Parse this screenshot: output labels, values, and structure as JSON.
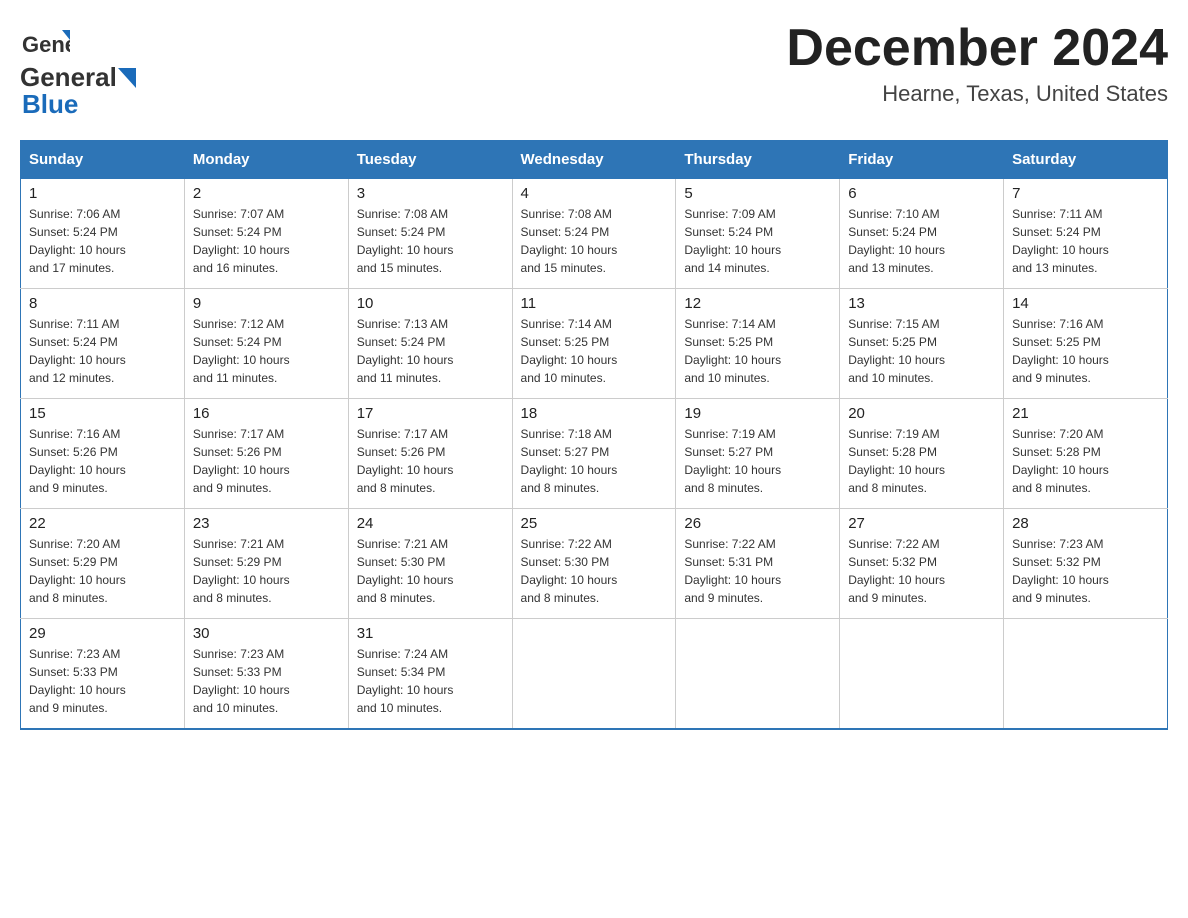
{
  "header": {
    "logo_general": "General",
    "logo_blue": "Blue",
    "title": "December 2024",
    "subtitle": "Hearne, Texas, United States"
  },
  "days_of_week": [
    "Sunday",
    "Monday",
    "Tuesday",
    "Wednesday",
    "Thursday",
    "Friday",
    "Saturday"
  ],
  "weeks": [
    [
      {
        "day": "1",
        "info": "Sunrise: 7:06 AM\nSunset: 5:24 PM\nDaylight: 10 hours\nand 17 minutes."
      },
      {
        "day": "2",
        "info": "Sunrise: 7:07 AM\nSunset: 5:24 PM\nDaylight: 10 hours\nand 16 minutes."
      },
      {
        "day": "3",
        "info": "Sunrise: 7:08 AM\nSunset: 5:24 PM\nDaylight: 10 hours\nand 15 minutes."
      },
      {
        "day": "4",
        "info": "Sunrise: 7:08 AM\nSunset: 5:24 PM\nDaylight: 10 hours\nand 15 minutes."
      },
      {
        "day": "5",
        "info": "Sunrise: 7:09 AM\nSunset: 5:24 PM\nDaylight: 10 hours\nand 14 minutes."
      },
      {
        "day": "6",
        "info": "Sunrise: 7:10 AM\nSunset: 5:24 PM\nDaylight: 10 hours\nand 13 minutes."
      },
      {
        "day": "7",
        "info": "Sunrise: 7:11 AM\nSunset: 5:24 PM\nDaylight: 10 hours\nand 13 minutes."
      }
    ],
    [
      {
        "day": "8",
        "info": "Sunrise: 7:11 AM\nSunset: 5:24 PM\nDaylight: 10 hours\nand 12 minutes."
      },
      {
        "day": "9",
        "info": "Sunrise: 7:12 AM\nSunset: 5:24 PM\nDaylight: 10 hours\nand 11 minutes."
      },
      {
        "day": "10",
        "info": "Sunrise: 7:13 AM\nSunset: 5:24 PM\nDaylight: 10 hours\nand 11 minutes."
      },
      {
        "day": "11",
        "info": "Sunrise: 7:14 AM\nSunset: 5:25 PM\nDaylight: 10 hours\nand 10 minutes."
      },
      {
        "day": "12",
        "info": "Sunrise: 7:14 AM\nSunset: 5:25 PM\nDaylight: 10 hours\nand 10 minutes."
      },
      {
        "day": "13",
        "info": "Sunrise: 7:15 AM\nSunset: 5:25 PM\nDaylight: 10 hours\nand 10 minutes."
      },
      {
        "day": "14",
        "info": "Sunrise: 7:16 AM\nSunset: 5:25 PM\nDaylight: 10 hours\nand 9 minutes."
      }
    ],
    [
      {
        "day": "15",
        "info": "Sunrise: 7:16 AM\nSunset: 5:26 PM\nDaylight: 10 hours\nand 9 minutes."
      },
      {
        "day": "16",
        "info": "Sunrise: 7:17 AM\nSunset: 5:26 PM\nDaylight: 10 hours\nand 9 minutes."
      },
      {
        "day": "17",
        "info": "Sunrise: 7:17 AM\nSunset: 5:26 PM\nDaylight: 10 hours\nand 8 minutes."
      },
      {
        "day": "18",
        "info": "Sunrise: 7:18 AM\nSunset: 5:27 PM\nDaylight: 10 hours\nand 8 minutes."
      },
      {
        "day": "19",
        "info": "Sunrise: 7:19 AM\nSunset: 5:27 PM\nDaylight: 10 hours\nand 8 minutes."
      },
      {
        "day": "20",
        "info": "Sunrise: 7:19 AM\nSunset: 5:28 PM\nDaylight: 10 hours\nand 8 minutes."
      },
      {
        "day": "21",
        "info": "Sunrise: 7:20 AM\nSunset: 5:28 PM\nDaylight: 10 hours\nand 8 minutes."
      }
    ],
    [
      {
        "day": "22",
        "info": "Sunrise: 7:20 AM\nSunset: 5:29 PM\nDaylight: 10 hours\nand 8 minutes."
      },
      {
        "day": "23",
        "info": "Sunrise: 7:21 AM\nSunset: 5:29 PM\nDaylight: 10 hours\nand 8 minutes."
      },
      {
        "day": "24",
        "info": "Sunrise: 7:21 AM\nSunset: 5:30 PM\nDaylight: 10 hours\nand 8 minutes."
      },
      {
        "day": "25",
        "info": "Sunrise: 7:22 AM\nSunset: 5:30 PM\nDaylight: 10 hours\nand 8 minutes."
      },
      {
        "day": "26",
        "info": "Sunrise: 7:22 AM\nSunset: 5:31 PM\nDaylight: 10 hours\nand 9 minutes."
      },
      {
        "day": "27",
        "info": "Sunrise: 7:22 AM\nSunset: 5:32 PM\nDaylight: 10 hours\nand 9 minutes."
      },
      {
        "day": "28",
        "info": "Sunrise: 7:23 AM\nSunset: 5:32 PM\nDaylight: 10 hours\nand 9 minutes."
      }
    ],
    [
      {
        "day": "29",
        "info": "Sunrise: 7:23 AM\nSunset: 5:33 PM\nDaylight: 10 hours\nand 9 minutes."
      },
      {
        "day": "30",
        "info": "Sunrise: 7:23 AM\nSunset: 5:33 PM\nDaylight: 10 hours\nand 10 minutes."
      },
      {
        "day": "31",
        "info": "Sunrise: 7:24 AM\nSunset: 5:34 PM\nDaylight: 10 hours\nand 10 minutes."
      },
      {
        "day": "",
        "info": ""
      },
      {
        "day": "",
        "info": ""
      },
      {
        "day": "",
        "info": ""
      },
      {
        "day": "",
        "info": ""
      }
    ]
  ]
}
